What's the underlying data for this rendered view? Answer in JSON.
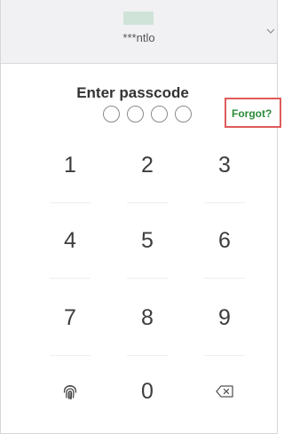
{
  "header": {
    "username": "***ntlo",
    "avatar_color": "#cfe3d8",
    "chevron": "chevron-down-icon"
  },
  "passcode": {
    "title": "Enter passcode",
    "dot_count": 4,
    "forgot_label": "Forgot?",
    "forgot_color": "#2a8a3a",
    "highlight_color": "#e05a5a"
  },
  "keypad": {
    "keys": [
      "1",
      "2",
      "3",
      "4",
      "5",
      "6",
      "7",
      "8",
      "9"
    ],
    "zero": "0",
    "left_icon": "fingerprint-icon",
    "right_icon": "backspace-icon"
  }
}
